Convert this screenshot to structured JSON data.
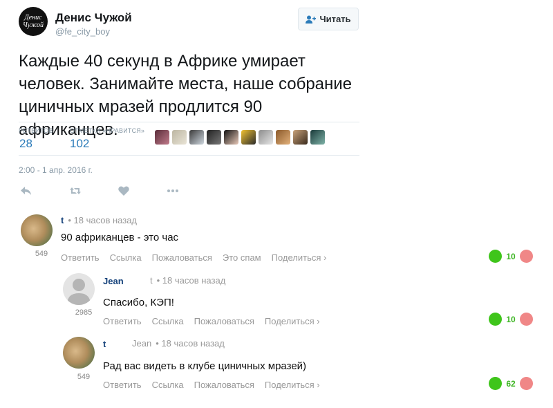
{
  "tweet": {
    "author": {
      "avatar_text": "Денис Чужой",
      "name": "Денис Чужой",
      "handle": "@fe_city_boy"
    },
    "follow_label": "Читать",
    "text": "Каждые 40 секунд в Африке умирает человек. Занимайте места, наше собрание циничных мразей продлится 90 африканцев.",
    "stats": {
      "retweets_label": "РЕТВИТОВ",
      "retweets": "28",
      "likes_label": "ОТМЕТКИ «НРАВИТСЯ»",
      "likes": "102"
    },
    "liker_faces": 10,
    "time": "2:00 - 1 апр. 2016 г.",
    "actions": [
      "reply-icon",
      "retweet-icon",
      "heart-icon",
      "more-icon"
    ]
  },
  "comments": [
    {
      "author": "t",
      "reply_to": "",
      "time": "• 18 часов назад",
      "text": "90 африканцев - это час",
      "count": "549",
      "actions": [
        "Ответить",
        "Ссылка",
        "Пожаловаться",
        "Это спам",
        "Поделиться ›"
      ],
      "votes": "10"
    },
    {
      "author": "Jean",
      "reply_to": "t",
      "time": "• 18 часов назад",
      "text": "Спасибо, КЭП!",
      "count": "2985",
      "actions": [
        "Ответить",
        "Ссылка",
        "Пожаловаться",
        "Поделиться ›"
      ],
      "votes": "10"
    },
    {
      "author": "t",
      "reply_to": "Jean",
      "time": "• 18 часов назад",
      "text": "Рад вас видеть в клубе циничных мразей)",
      "count": "549",
      "actions": [
        "Ответить",
        "Ссылка",
        "Пожаловаться",
        "Поделиться ›"
      ],
      "votes": "62"
    }
  ],
  "colors": {
    "link_blue": "#2b7bb9",
    "vote_up": "#3fc51b",
    "vote_down": "#f08787",
    "muted": "#8899a6"
  }
}
